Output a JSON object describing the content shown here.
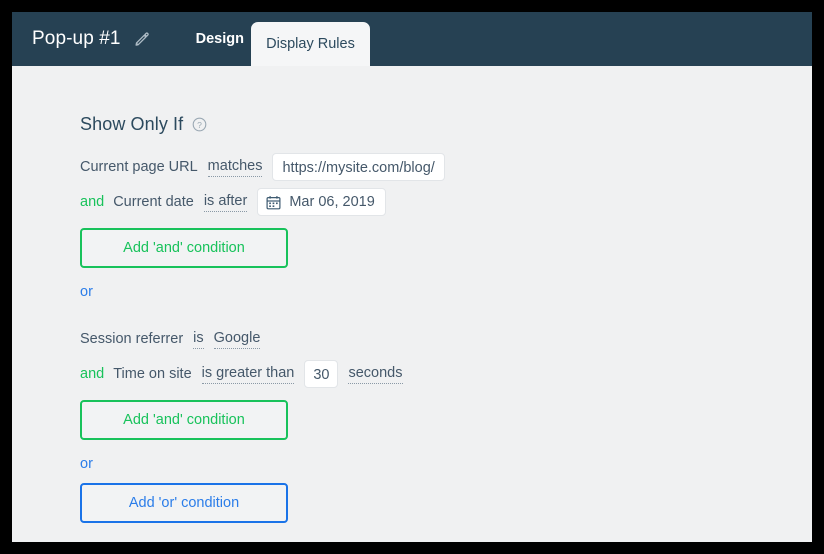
{
  "header": {
    "popup_title": "Pop-up #1",
    "edit_icon": "pencil-icon",
    "tabs": [
      {
        "label": "Design",
        "active": false
      },
      {
        "label": "Display Rules",
        "active": true
      }
    ]
  },
  "colors": {
    "header_bg": "#264153",
    "page_bg": "#f0f1f2",
    "green": "#18c25b",
    "blue": "#2b7de9",
    "text": "#45586a",
    "title": "#2c4a5e"
  },
  "main": {
    "section_title": "Show Only If",
    "help_icon": "question-mark-circle-icon",
    "groups": [
      {
        "conditions": [
          {
            "conjunction": "",
            "subject": "Current page URL",
            "operator": "matches",
            "value_type": "text",
            "value": "https://mysite.com/blog/",
            "unit": ""
          },
          {
            "conjunction": "and",
            "subject": "Current date",
            "operator": "is after",
            "value_type": "date",
            "value": "Mar 06, 2019",
            "value_icon": "calendar-icon",
            "unit": ""
          }
        ],
        "add_and_label": "Add 'and' condition",
        "or_separator": "or"
      },
      {
        "conditions": [
          {
            "conjunction": "",
            "subject": "Session referrer",
            "operator": "is",
            "value_type": "dotted",
            "value": "Google",
            "unit": ""
          },
          {
            "conjunction": "and",
            "subject": "Time on site",
            "operator": "is greater than",
            "value_type": "number",
            "value": "30",
            "unit": "seconds"
          }
        ],
        "add_and_label": "Add 'and' condition",
        "or_separator": "or"
      }
    ],
    "add_or_label": "Add 'or' condition"
  }
}
